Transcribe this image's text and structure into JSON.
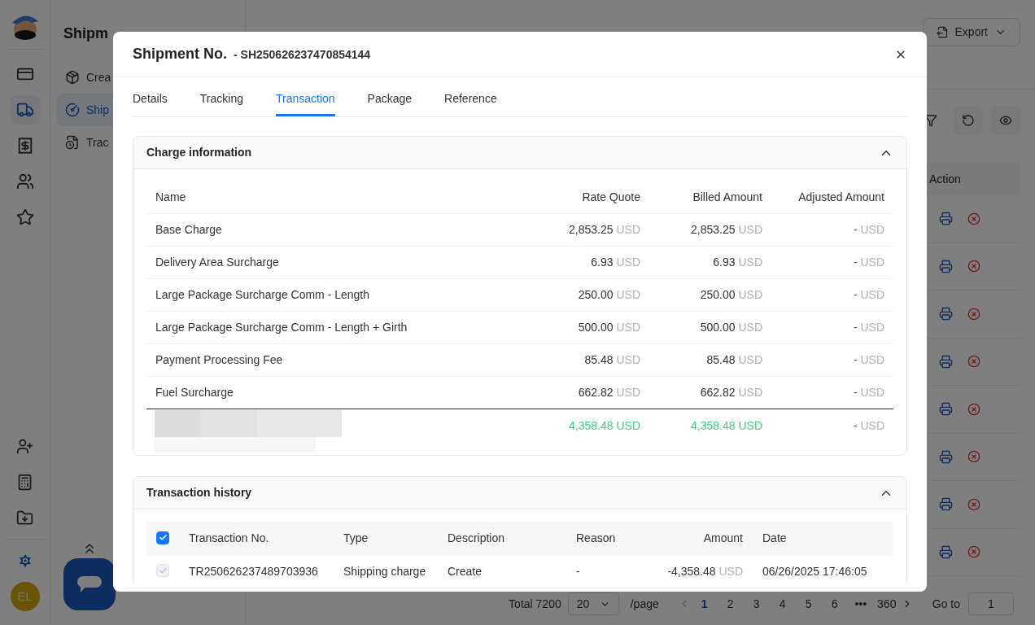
{
  "rail": {
    "items": [
      {
        "selected": false
      },
      {
        "selected": true
      },
      {
        "selected": false
      },
      {
        "selected": false
      },
      {
        "selected": false
      }
    ],
    "bottom_items": [
      {
        "selected": false
      },
      {
        "selected": false
      },
      {
        "selected": false
      }
    ],
    "settings": {
      "selected": true
    },
    "avatar": "EL"
  },
  "submenu": {
    "title": "Shipm",
    "items": [
      {
        "label": "Crea",
        "selected": false
      },
      {
        "label": "Ship",
        "selected": true
      },
      {
        "label": "Trac",
        "selected": false
      }
    ]
  },
  "page": {
    "export": "Export",
    "table": {
      "action_header": "Action"
    },
    "pagination": {
      "total": "Total 7200",
      "page_size": "20",
      "per_page": "/page",
      "pages": [
        {
          "label": "1",
          "selected": true
        },
        {
          "label": "2",
          "selected": false
        },
        {
          "label": "3",
          "selected": false
        },
        {
          "label": "4",
          "selected": false
        },
        {
          "label": "5",
          "selected": false
        },
        {
          "label": "6",
          "selected": false
        },
        {
          "label": "•••",
          "selected": false
        },
        {
          "label": "360",
          "selected": false
        }
      ],
      "goto": "Go to",
      "goto_value": "1"
    }
  },
  "modal": {
    "title": "Shipment No.",
    "number": "- SH250626237470854144",
    "tabs": [
      {
        "label": "Details",
        "selected": false
      },
      {
        "label": "Tracking",
        "selected": false
      },
      {
        "label": "Transaction",
        "selected": true
      },
      {
        "label": "Package",
        "selected": false
      },
      {
        "label": "Reference",
        "selected": false
      }
    ],
    "charge": {
      "title": "Charge information",
      "expanded": true,
      "columns": [
        "Name",
        "Rate Quote",
        "Billed Amount",
        "Adjusted Amount"
      ],
      "rows": [
        {
          "name": "Base Charge",
          "rate": "2,853.25",
          "rate_currency": "USD",
          "billed": "2,853.25",
          "billed_currency": "USD",
          "adjusted": "-",
          "adjusted_currency": "USD"
        },
        {
          "name": "Delivery Area Surcharge",
          "rate": "6.93",
          "rate_currency": "USD",
          "billed": "6.93",
          "billed_currency": "USD",
          "adjusted": "-",
          "adjusted_currency": "USD"
        },
        {
          "name": "Large Package Surcharge Comm - Length",
          "rate": "250.00",
          "rate_currency": "USD",
          "billed": "250.00",
          "billed_currency": "USD",
          "adjusted": "-",
          "adjusted_currency": "USD"
        },
        {
          "name": "Large Package Surcharge Comm - Length + Girth",
          "rate": "500.00",
          "rate_currency": "USD",
          "billed": "500.00",
          "billed_currency": "USD",
          "adjusted": "-",
          "adjusted_currency": "USD"
        },
        {
          "name": "Payment Processing Fee",
          "rate": "85.48",
          "rate_currency": "USD",
          "billed": "85.48",
          "billed_currency": "USD",
          "adjusted": "-",
          "adjusted_currency": "USD"
        },
        {
          "name": "Fuel Surcharge",
          "rate": "662.82",
          "rate_currency": "USD",
          "billed": "662.82",
          "billed_currency": "USD",
          "adjusted": "-",
          "adjusted_currency": "USD"
        }
      ],
      "total": {
        "rate": "4,358.48 USD",
        "billed": "4,358.48 USD",
        "adjusted": "-",
        "currency": "USD"
      }
    },
    "history": {
      "title": "Transaction history",
      "expanded": true,
      "all_checked": true,
      "columns": [
        "Transaction No.",
        "Type",
        "Description",
        "Reason",
        "Amount",
        "Date"
      ],
      "rows": [
        {
          "checked": true,
          "disabled": true,
          "number": "TR250626237489703936",
          "type": "Shipping charge",
          "description": "Create",
          "reason": "-",
          "amount": "-4,358.48",
          "currency": "USD",
          "date": "06/26/2025 17:46:05"
        }
      ]
    }
  }
}
